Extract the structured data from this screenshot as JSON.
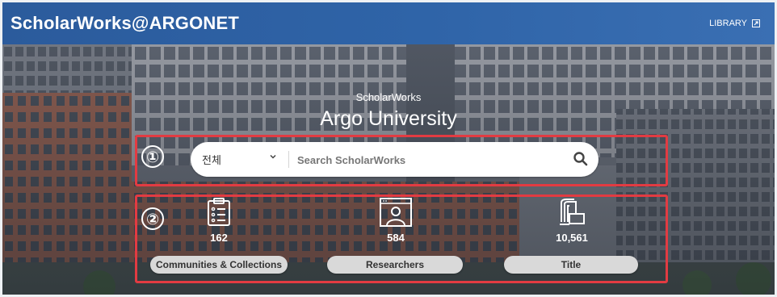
{
  "header": {
    "brand": "ScholarWorks@ARGONET",
    "library_link": "LIBRARY",
    "library_icon": "external-link-icon"
  },
  "hero": {
    "subtitle": "ScholarWorks",
    "title": "Argo University"
  },
  "annotations": [
    "①",
    "②"
  ],
  "search": {
    "scope_value": "전체",
    "placeholder": "Search ScholarWorks",
    "icon": "search-icon"
  },
  "stats": [
    {
      "icon": "clipboard-list-icon",
      "count": "162",
      "label": "Communities & Collections"
    },
    {
      "icon": "researcher-portrait-icon",
      "count": "584",
      "label": "Researchers"
    },
    {
      "icon": "documents-stack-icon",
      "count": "10,561",
      "label": "Title"
    }
  ],
  "colors": {
    "header_bg": "#2f64a8",
    "annotation_red": "#e23b42",
    "pill_bg": "#d9d9d9"
  }
}
